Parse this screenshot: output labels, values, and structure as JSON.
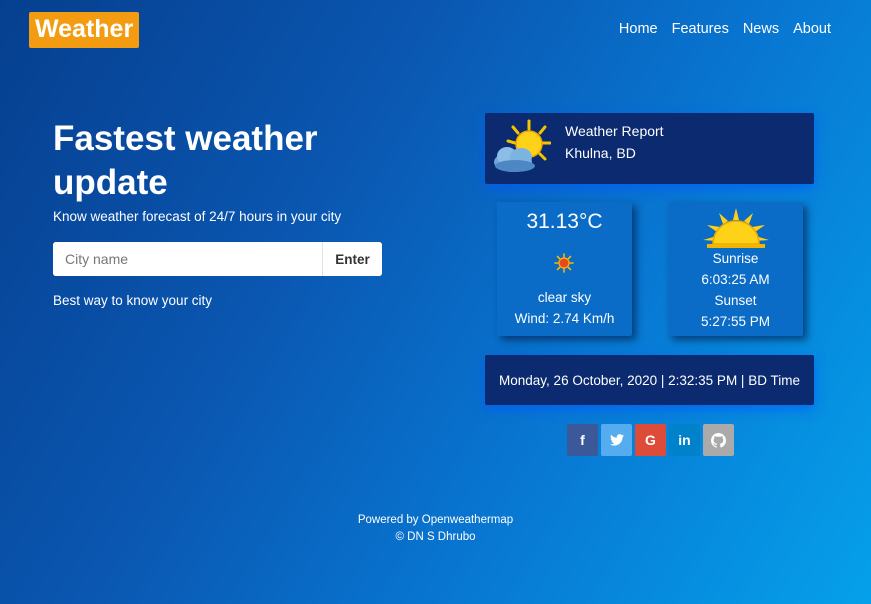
{
  "brand": {
    "logo": "Weather"
  },
  "nav": {
    "items": [
      "Home",
      "Features",
      "News",
      "About"
    ]
  },
  "hero": {
    "title": "Fastest weather update",
    "subtitle": "Know weather forecast of 24/7 hours in your city",
    "tagline": "Best way to know your city"
  },
  "search": {
    "placeholder": "City name",
    "value": "",
    "button_label": "Enter"
  },
  "report": {
    "title": "Weather Report",
    "location": "Khulna, BD",
    "icon": "sun-behind-cloud-icon"
  },
  "current": {
    "temperature": "31.13°C",
    "condition": "clear sky",
    "wind": "Wind: 2.74 Km/h",
    "icon": "small-sun-icon"
  },
  "sun": {
    "sunrise_label": "Sunrise",
    "sunrise_time": "6:03:25 AM",
    "sunset_label": "Sunset",
    "sunset_time": "5:27:55 PM",
    "icon": "sun-icon"
  },
  "datetime": "Monday, 26 October, 2020 | 2:32:35 PM | BD Time",
  "social": [
    {
      "name": "facebook",
      "glyph": "f",
      "color": "#3b5998"
    },
    {
      "name": "twitter",
      "glyph": "t",
      "color": "#55acee"
    },
    {
      "name": "google",
      "glyph": "G",
      "color": "#dd4b39"
    },
    {
      "name": "linkedin",
      "glyph": "in",
      "color": "#0082ca"
    },
    {
      "name": "github",
      "glyph": "gh",
      "color": "#aaaaaa"
    }
  ],
  "footer": {
    "powered": "Powered by Openweathermap",
    "credit": "© DN S Dhrubo"
  },
  "colors": {
    "logo_bg": "#f39c11",
    "card_dark": "#0b2a70",
    "card_mid": "#0a6cc6"
  }
}
